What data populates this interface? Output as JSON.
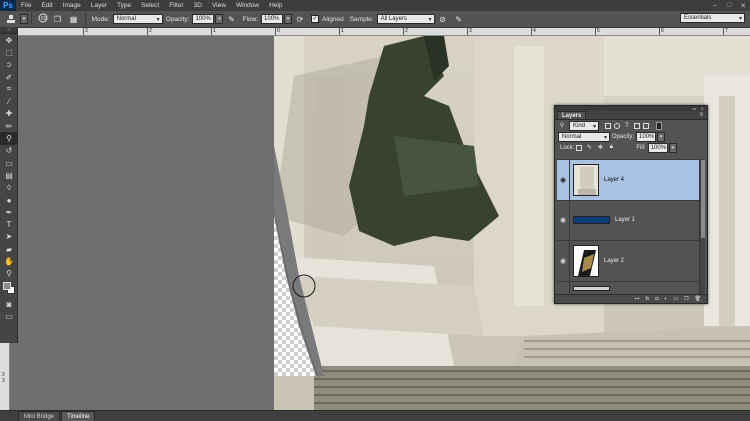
{
  "app": {
    "logo": "Ps",
    "menu": [
      "File",
      "Edit",
      "Image",
      "Layer",
      "Type",
      "Select",
      "Filter",
      "3D",
      "View",
      "Window",
      "Help"
    ],
    "window_controls": [
      "–",
      "□",
      "✕"
    ]
  },
  "options": {
    "brush_size": "60",
    "mode_label": "Mode:",
    "mode_value": "Normal",
    "opacity_label": "Opacity:",
    "opacity_value": "100%",
    "flow_label": "Flow:",
    "flow_value": "100%",
    "aligned_label": "Aligned",
    "sample_label": "Sample:",
    "sample_value": "All Layers",
    "workspace": "Essentials"
  },
  "ruler": {
    "top_labels": [
      "3",
      "2",
      "1",
      "0",
      "1",
      "2",
      "3",
      "4",
      "5",
      "6",
      "7"
    ],
    "left_labels": [
      "2",
      "3"
    ]
  },
  "bottom_tabs": [
    "Mini Bridge",
    "Timeline"
  ],
  "layers_panel": {
    "title": "Layers",
    "filter_kind": "Kind",
    "blend_mode": "Normal",
    "opacity_label": "Opacity:",
    "opacity_value": "100%",
    "lock_label": "Lock:",
    "fill_label": "Fill:",
    "fill_value": "100%",
    "layers": [
      {
        "name": "Layer 4",
        "visible": true,
        "selected": true
      },
      {
        "name": "Layer 1",
        "visible": true,
        "selected": false
      },
      {
        "name": "Layer 2",
        "visible": true,
        "selected": false
      }
    ]
  },
  "colors": {
    "accent_selection": "#a9c2e2",
    "layer1_fill": "#0d3d78"
  },
  "icons": {
    "toolbox": [
      "move-icon",
      "marquee-icon",
      "lasso-icon",
      "quick-select-icon",
      "crop-icon",
      "eyedropper-icon",
      "healing-icon",
      "brush-icon",
      "clone-stamp-icon",
      "history-brush-icon",
      "eraser-icon",
      "gradient-icon",
      "blur-icon",
      "dodge-icon",
      "pen-icon",
      "type-icon",
      "path-select-icon",
      "shape-icon",
      "hand-icon",
      "zoom-icon",
      "quick-mask-icon",
      "screen-mode-icon"
    ],
    "active_tool": "clone-stamp-icon"
  }
}
